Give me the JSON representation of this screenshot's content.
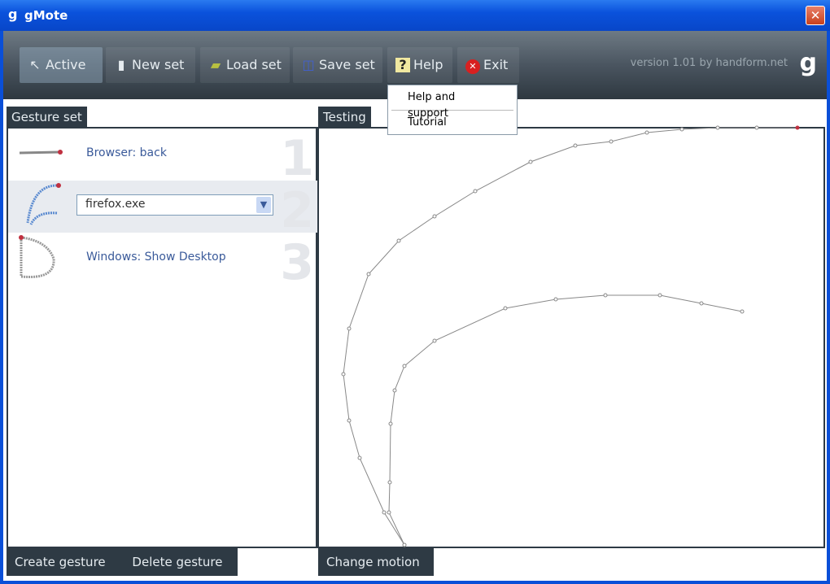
{
  "window": {
    "logo": "g",
    "title": "gMote",
    "close": "✕"
  },
  "toolbar": {
    "buttons": [
      {
        "label": "Active",
        "icon": "↖"
      },
      {
        "label": "New set",
        "icon": "▮"
      },
      {
        "label": "Load set",
        "icon": "▰"
      },
      {
        "label": "Save set",
        "icon": "◫"
      },
      {
        "label": "Help",
        "icon": "?"
      },
      {
        "label": "Exit",
        "icon": "✕"
      }
    ],
    "version": "version 1.01 by handform.net",
    "logo": "g"
  },
  "help_menu": {
    "items": [
      "Help and support",
      "Tutorial"
    ]
  },
  "gesture_set": {
    "tab": "Gesture set",
    "rows": [
      {
        "label": "Browser: back",
        "num": "1"
      },
      {
        "value": "firefox.exe",
        "num": "2"
      },
      {
        "label": "Windows: Show Desktop",
        "num": "3"
      }
    ],
    "create": "Create gesture",
    "delete": "Delete gesture"
  },
  "testing": {
    "tab": "Testing",
    "change": "Change motion"
  }
}
